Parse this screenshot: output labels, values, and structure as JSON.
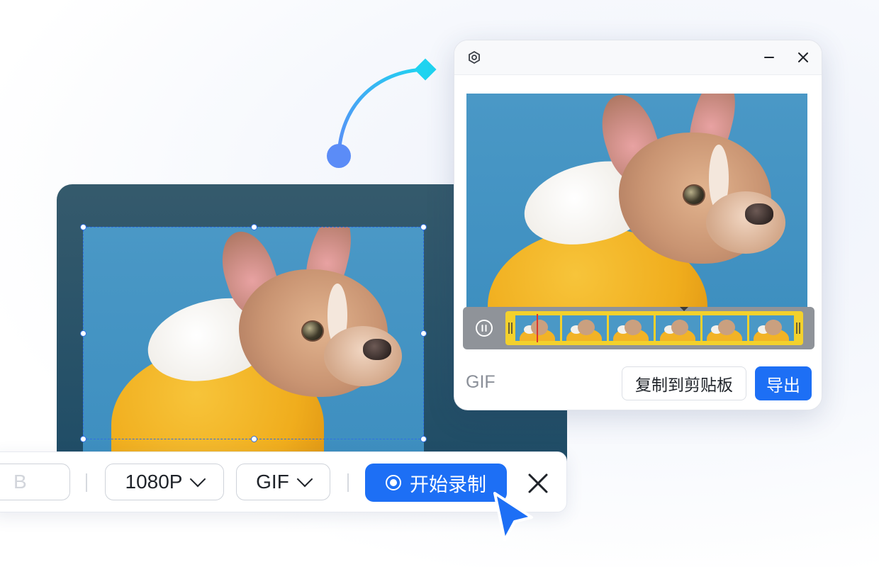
{
  "toolbar": {
    "partial_select_label": "B",
    "resolution_label": "1080P",
    "format_label": "GIF",
    "record_label": "开始录制"
  },
  "popup": {
    "format_label": "GIF",
    "copy_label": "复制到剪贴板",
    "export_label": "导出"
  },
  "colors": {
    "accent": "#1d6ff5",
    "connector_start": "#5b8cf7",
    "connector_end": "#1fd3f0",
    "trim_handle": "#f3d12c"
  },
  "icons": {
    "settings": "settings-icon",
    "minimize": "minimize-icon",
    "close": "close-icon",
    "pause": "pause-icon",
    "record": "record-icon",
    "cursor": "cursor-icon",
    "chevron": "chevron-down-icon"
  }
}
